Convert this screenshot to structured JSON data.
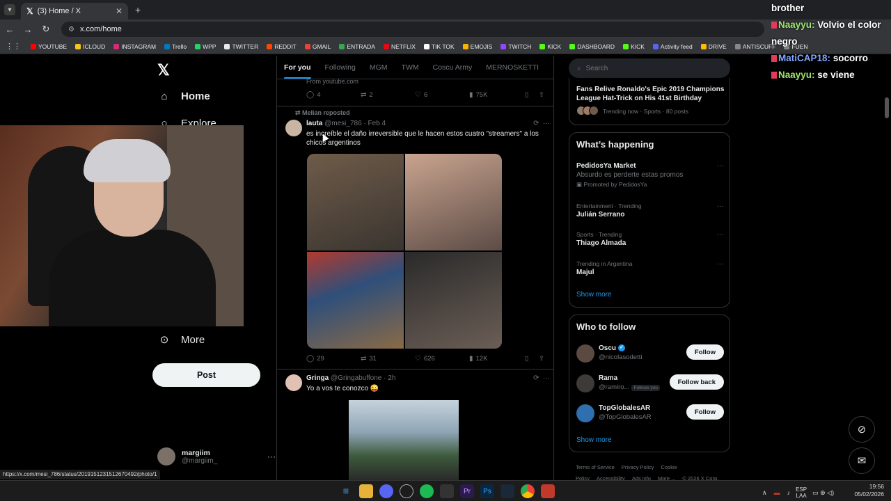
{
  "browser": {
    "tab_title": "(3) Home / X",
    "url": "x.com/home",
    "bookmarks": [
      {
        "label": "YOUTUBE",
        "color": "#ff0000"
      },
      {
        "label": "ICLOUD",
        "color": "#f5c518"
      },
      {
        "label": "INSTAGRAM",
        "color": "#d62976"
      },
      {
        "label": "Trello",
        "color": "#0079bf"
      },
      {
        "label": "WPP",
        "color": "#25d366"
      },
      {
        "label": "TWITTER",
        "color": "#e7e9ea"
      },
      {
        "label": "REDDIT",
        "color": "#ff4500"
      },
      {
        "label": "GMAIL",
        "color": "#ea4335"
      },
      {
        "label": "ENTRADA",
        "color": "#34a853"
      },
      {
        "label": "NETFLIX",
        "color": "#e50914"
      },
      {
        "label": "TIK TOK",
        "color": "#ffffff"
      },
      {
        "label": "EMOJIS",
        "color": "#f7b500"
      },
      {
        "label": "TWITCH",
        "color": "#9146ff"
      },
      {
        "label": "KICK",
        "color": "#53fc18"
      },
      {
        "label": "DASHBOARD",
        "color": "#53fc18"
      },
      {
        "label": "KICK",
        "color": "#53fc18"
      },
      {
        "label": "Activity feed",
        "color": "#5865f2"
      },
      {
        "label": "DRIVE",
        "color": "#fbbc04"
      },
      {
        "label": "ANTISCUFF",
        "color": "#888888"
      },
      {
        "label": "FUEN",
        "color": "#888888"
      }
    ]
  },
  "chat": [
    {
      "user": "",
      "text": "brother"
    },
    {
      "user": "Naayyu:",
      "text": "Volvio el color negro"
    },
    {
      "user": "MatiCAP18:",
      "text": "socorro"
    },
    {
      "user": "Naayyu:",
      "text": "se viene"
    }
  ],
  "leftnav": {
    "home": "Home",
    "explore": "Explore",
    "more": "More",
    "post": "Post",
    "account_name": "margiim",
    "account_handle": "@margiim_"
  },
  "feed": {
    "tabs": [
      "For you",
      "Following",
      "MGM",
      "TWM",
      "Coscu Army",
      "MERNOSKETTI"
    ],
    "from_youtube": "From youtube.com",
    "top_actions": {
      "replies": "4",
      "reposts": "2",
      "likes": "6",
      "views": "75K"
    },
    "repost_label": "Melian reposted",
    "tweet1": {
      "name": "lauta",
      "handle": "@mesi_786 · Feb 4",
      "text": "es increíble el daño irreversible que le hacen estos cuatro \"streamers\" a los chicos argentinos",
      "replies": "29",
      "reposts": "31",
      "likes": "626",
      "views": "12K"
    },
    "tweet2": {
      "name": "Gringa",
      "handle": "@Gringabuffone · 2h",
      "text": "Yo a vos te conozco 😜"
    }
  },
  "right": {
    "search_placeholder": "Search",
    "news_title": "Fans Relive Ronaldo's Epic 2019 Champions League Hat-Trick on His 41st Birthday",
    "news_meta": "Trending now · Sports · 80 posts",
    "happening_title": "What’s happening",
    "trends": [
      {
        "meta": "",
        "title": "PedidosYa Market",
        "sub": "Absurdo es perderte estas promos",
        "promo": "Promoted by PedidosYa"
      },
      {
        "meta": "Entertainment · Trending",
        "title": "Julián Serrano"
      },
      {
        "meta": "Sports · Trending",
        "title": "Thiago Almada"
      },
      {
        "meta": "Trending in Argentina",
        "title": "Majul"
      }
    ],
    "show_more": "Show more",
    "follow_title": "Who to follow",
    "follow": [
      {
        "name": "Oscu",
        "handle": "@nicolasodetti",
        "button": "Follow"
      },
      {
        "name": "Rama",
        "handle": "@ramiro...",
        "badge": "Follows you",
        "button": "Follow back"
      },
      {
        "name": "TopGlobalesAR",
        "handle": "@TopGlobalesAR",
        "button": "Follow"
      }
    ],
    "footer": [
      "Terms of Service",
      "Privacy Policy",
      "Cookie Policy",
      "Accessibility",
      "Ads info",
      "More ...",
      "© 2026 X Corp."
    ]
  },
  "status_url": "https://x.com/mesi_786/status/2019151231512670492/photo/1",
  "taskbar": {
    "lang_top": "ESP",
    "lang_bottom": "LAA",
    "time": "19:56",
    "date": "05/02/2026"
  }
}
